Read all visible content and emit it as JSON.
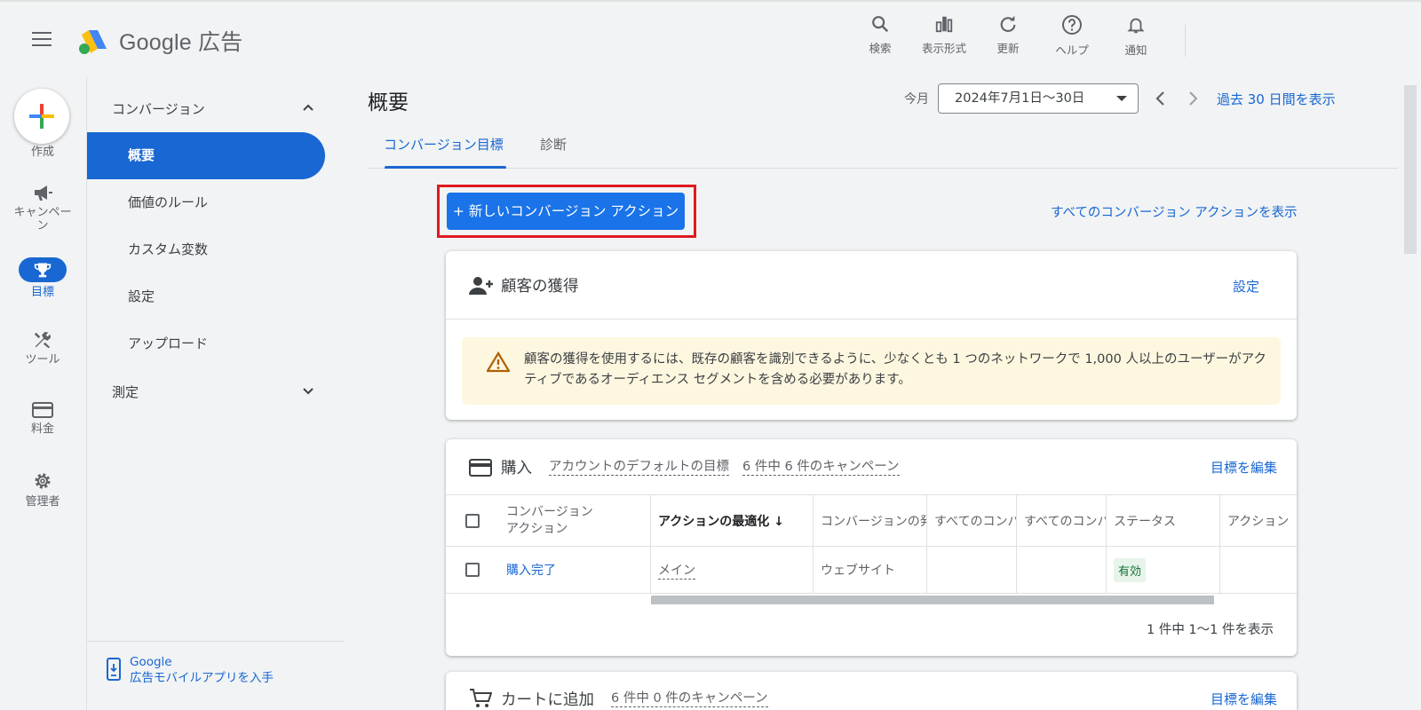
{
  "topbar": {
    "logo_text": "Google 広告",
    "actions": [
      {
        "icon": "search-icon",
        "label": "検索"
      },
      {
        "icon": "bar-chart-icon",
        "label": "表示形式"
      },
      {
        "icon": "refresh-icon",
        "label": "更新"
      },
      {
        "icon": "help-icon",
        "label": "ヘルプ"
      },
      {
        "icon": "bell-icon",
        "label": "通知"
      }
    ]
  },
  "rail": {
    "create_label": "作成",
    "items": [
      {
        "icon": "megaphone-icon",
        "label": "キャンペーン"
      },
      {
        "icon": "trophy-icon",
        "label": "目標"
      },
      {
        "icon": "wrench-icon",
        "label": "ツール"
      },
      {
        "icon": "credit-card-icon",
        "label": "料金"
      },
      {
        "icon": "gear-icon",
        "label": "管理者"
      }
    ]
  },
  "subnav": {
    "section_conversions": "コンバージョン",
    "items": [
      "概要",
      "価値のルール",
      "カスタム変数",
      "設定",
      "アップロード"
    ],
    "section_measurement": "測定",
    "footer_line1": "Google",
    "footer_line2": "広告モバイルアプリを入手"
  },
  "main": {
    "title": "概要",
    "date_prefix": "今月",
    "date_range": "2024年7月1日～30日",
    "date_link": "過去 30 日間を表示",
    "tabs": [
      "コンバージョン目標",
      "診断"
    ],
    "new_action_button": "+ 新しいコンバージョン アクション",
    "all_actions_link": "すべてのコンバージョン アクションを表示"
  },
  "acquisition_card": {
    "title": "顧客の獲得",
    "action": "設定",
    "warning": "顧客の獲得を使用するには、既存の顧客を識別できるように、少なくとも 1 つのネットワークで 1,000 人以上のユーザーがアクティブであるオーディエンス セグメントを含める必要があります。"
  },
  "purchase_card": {
    "title": "購入",
    "chip1": "アカウントのデフォルトの目標",
    "chip2": "6 件中 6 件のキャンペーン",
    "action": "目標を編集",
    "columns": [
      "コンバージョン\nアクション",
      "アクションの最適化 ↓",
      "コンバージョンの発生元",
      "すべてのコンバージョン",
      "すべてのコンバージョン値",
      "ステータス",
      "アクション"
    ],
    "rows": [
      {
        "name": "購入完了",
        "optimization": "メイン",
        "source": "ウェブサイト",
        "all_conv": "",
        "all_value": "",
        "status": "有効",
        "action": ""
      }
    ],
    "pager": "1 件中 1～1 件を表示"
  },
  "cart_card": {
    "title": "カートに追加",
    "chip": "6 件中 0 件のキャンペーン",
    "action": "目標を編集"
  },
  "colors": {
    "accent": "#1a73e8",
    "link": "#1967d2",
    "highlight_border": "#e0191f",
    "warning_bg": "#fef7e0"
  }
}
